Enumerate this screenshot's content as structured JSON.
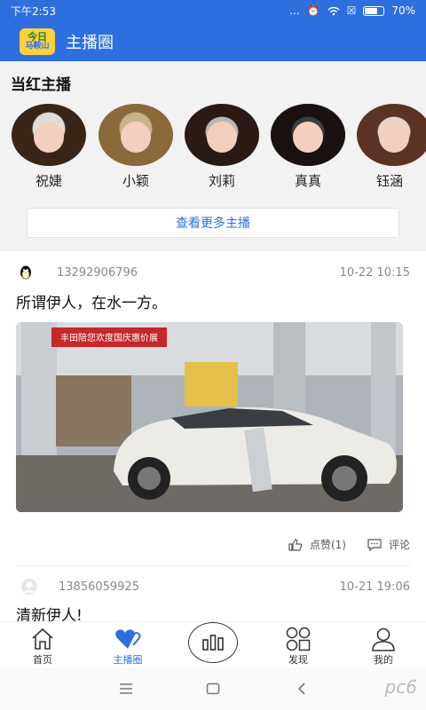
{
  "status_bar": {
    "time": "下午2:53",
    "signal": "...",
    "battery": "70%"
  },
  "app_bar": {
    "logo_line1": "今日",
    "logo_line2": "马鞍山",
    "title": "主播圈"
  },
  "hot_section": {
    "title": "当红主播",
    "hosts": [
      {
        "name": "祝婕"
      },
      {
        "name": "小颖"
      },
      {
        "name": "刘莉"
      },
      {
        "name": "真真"
      },
      {
        "name": "钰涵"
      }
    ],
    "more_label": "查看更多主播"
  },
  "posts": [
    {
      "user": "13292906796",
      "time": "10-22 10:15",
      "text": "所谓伊人，在水一方。",
      "photo_sign": "丰田陪您欢度国庆惠价展",
      "like_label": "点赞(1)",
      "comment_label": "评论"
    },
    {
      "user": "13856059925",
      "time": "10-21 19:06",
      "text": "清新伊人!"
    }
  ],
  "tab_bar": {
    "tabs": [
      {
        "label": "首页",
        "icon": "home-icon"
      },
      {
        "label": "主播圈",
        "icon": "hearts-icon"
      },
      {
        "label": "",
        "icon": "bars-icon"
      },
      {
        "label": "发现",
        "icon": "discover-icon"
      },
      {
        "label": "我的",
        "icon": "user-icon"
      }
    ],
    "active_color": "#2e6fe0"
  },
  "nav_bar": {
    "icons": [
      "menu-icon",
      "square-icon",
      "back-icon"
    ]
  },
  "watermark": "pc6"
}
